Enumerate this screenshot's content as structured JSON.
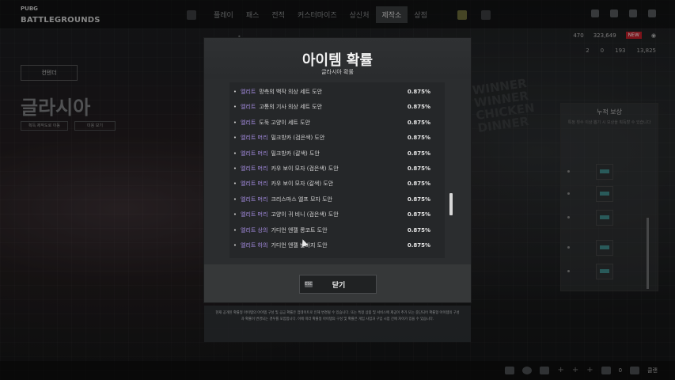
{
  "app": {
    "logo_top": "PUBG",
    "logo_main": "BATTLEGROUNDS"
  },
  "nav": {
    "items": [
      {
        "label": "플레이",
        "active": false
      },
      {
        "label": "패스",
        "active": false
      },
      {
        "label": "전적",
        "active": false
      },
      {
        "label": "커스터마이즈",
        "active": false
      },
      {
        "label": "상신처",
        "active": false
      },
      {
        "label": "제작소",
        "active": true
      },
      {
        "label": "상점",
        "active": false
      }
    ]
  },
  "currency": {
    "items": [
      "470",
      "323,649",
      "NEW"
    ],
    "items2": [
      "2",
      "0",
      "193",
      "13,825"
    ]
  },
  "left": {
    "tag": "컨텐더",
    "map_title": "글라시아",
    "btn1": "획득 제작도로 이동",
    "btn2": "미용 보기"
  },
  "right_panel": {
    "title": "누적 보상",
    "subtitle": "특정 횟수 이상 뽑기 시 보상을 획득할 수 있습니다"
  },
  "modal": {
    "title": "아이템 확률",
    "subtitle": "글라시아 확률",
    "items": [
      {
        "grade": "엘리트",
        "name": "망측의 백작 의상 세트 도안",
        "prob": "0.875%"
      },
      {
        "grade": "엘리트",
        "name": "고통의 기사 의상 세트 도안",
        "prob": "0.875%"
      },
      {
        "grade": "엘리트",
        "name": "도둑 고양이 세트 도안",
        "prob": "0.875%"
      },
      {
        "grade": "엘리트 머리",
        "name": "밀크방카 (검은색) 도안",
        "prob": "0.875%"
      },
      {
        "grade": "엘리트 머리",
        "name": "밀크방카 (갈색) 도안",
        "prob": "0.875%"
      },
      {
        "grade": "엘리트 머리",
        "name": "카우 보이 모자 (검은색) 도안",
        "prob": "0.875%"
      },
      {
        "grade": "엘리트 머리",
        "name": "카우 보이 모자 (갈색) 도안",
        "prob": "0.875%"
      },
      {
        "grade": "엘리트 머리",
        "name": "크리스마스 엘프 모자 도안",
        "prob": "0.875%"
      },
      {
        "grade": "엘리트 머리",
        "name": "고양이 귀 비니 (검은색) 도안",
        "prob": "0.875%"
      },
      {
        "grade": "엘리트 상의",
        "name": "가디언 엔젤 롱코트 도안",
        "prob": "0.875%"
      },
      {
        "grade": "엘리트 하의",
        "name": "가디언 엔젤 반바지 도안",
        "prob": "0.875%"
      }
    ],
    "close_key": "ESC",
    "close_label": "닫기"
  },
  "notice": {
    "text": "현재 공개된 확률형 아이템의 아이템 구성 및 공급 확률은 업데이트로 인해 변경될 수 있습니다. 또는 특정 상품 및 서비스에 제공이 추가 또는 중단되어 확률형 아이템의 구성과 확률이 변경되는 경우를 포함합니다. 이에 따라 확률형 아이템의 구성 및 확률은 게임 사업과 구입 시점 간에 차이가 있을 수 있습니다."
  },
  "bottom": {
    "count": "0",
    "label": "클랜"
  },
  "bg": {
    "winner": "WINNER WINNER CHICKEN DINNER"
  }
}
